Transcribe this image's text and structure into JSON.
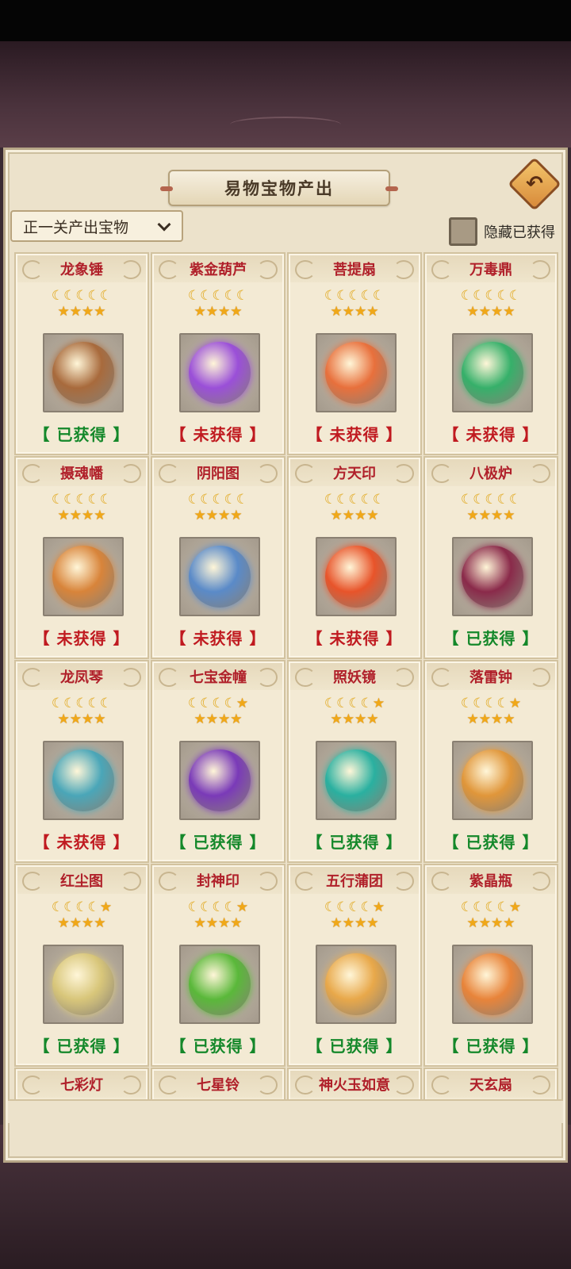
{
  "title": "易物宝物产出",
  "dropdown_label": "正一关产出宝物",
  "hide_obtained_label": "隐藏已获得",
  "status_owned": "【 已获得 】",
  "status_missing": "【 未获得 】",
  "items": [
    {
      "name": "龙象锤",
      "moons": 5,
      "stars": 4,
      "obtained": true,
      "art": "hammer-icon",
      "color": "#a86a3c"
    },
    {
      "name": "紫金葫芦",
      "moons": 5,
      "stars": 4,
      "obtained": false,
      "art": "gourd-icon",
      "color": "#9a4fd8"
    },
    {
      "name": "菩提扇",
      "moons": 5,
      "stars": 4,
      "obtained": false,
      "art": "fan-icon",
      "color": "#e8703c"
    },
    {
      "name": "万毒鼎",
      "moons": 5,
      "stars": 4,
      "obtained": false,
      "art": "cauldron-icon",
      "color": "#36b06a"
    },
    {
      "name": "摄魂幡",
      "moons": 5,
      "stars": 4,
      "obtained": false,
      "art": "banner-icon",
      "color": "#d8843a"
    },
    {
      "name": "阴阳图",
      "moons": 5,
      "stars": 4,
      "obtained": false,
      "art": "scroll-icon",
      "color": "#5a8ac8"
    },
    {
      "name": "方天印",
      "moons": 5,
      "stars": 4,
      "obtained": false,
      "art": "seal-icon",
      "color": "#e8542a"
    },
    {
      "name": "八极炉",
      "moons": 5,
      "stars": 4,
      "obtained": true,
      "art": "furnace-icon",
      "color": "#8a2a4a"
    },
    {
      "name": "龙凤琴",
      "moons": 5,
      "stars": 4,
      "obtained": false,
      "art": "zither-icon",
      "color": "#4aa6b8"
    },
    {
      "name": "七宝金幢",
      "moons": 4,
      "stars": 5,
      "obtained": true,
      "art": "umbrella-icon",
      "color": "#7a3ab8"
    },
    {
      "name": "照妖镜",
      "moons": 4,
      "stars": 5,
      "obtained": true,
      "art": "mirror-icon",
      "color": "#2ab0a0"
    },
    {
      "name": "落雷钟",
      "moons": 4,
      "stars": 5,
      "obtained": true,
      "art": "bell-icon",
      "color": "#e0963a"
    },
    {
      "name": "红尘图",
      "moons": 4,
      "stars": 5,
      "obtained": true,
      "art": "scroll-icon",
      "color": "#d8c67a"
    },
    {
      "name": "封神印",
      "moons": 4,
      "stars": 5,
      "obtained": true,
      "art": "seal-icon",
      "color": "#5ab83a"
    },
    {
      "name": "五行蒲团",
      "moons": 4,
      "stars": 5,
      "obtained": true,
      "art": "cushion-icon",
      "color": "#e8a84a"
    },
    {
      "name": "紫晶瓶",
      "moons": 4,
      "stars": 5,
      "obtained": true,
      "art": "vase-icon",
      "color": "#e8843a"
    },
    {
      "name": "七彩灯"
    },
    {
      "name": "七星铃"
    },
    {
      "name": "神火玉如意"
    },
    {
      "name": "天玄扇"
    }
  ]
}
